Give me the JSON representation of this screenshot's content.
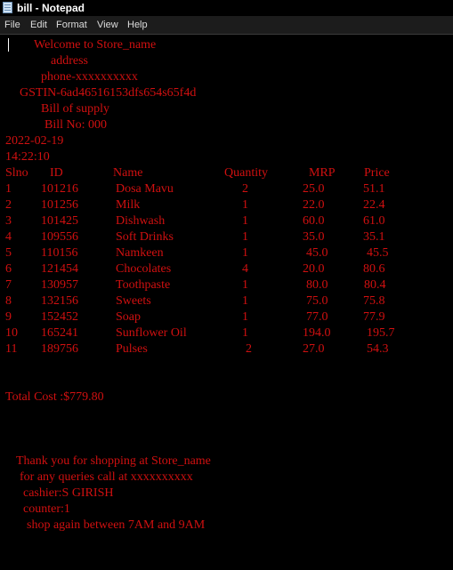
{
  "window": {
    "title": "bill - Notepad",
    "menu": [
      "File",
      "Edit",
      "Format",
      "View",
      "Help"
    ]
  },
  "bill": {
    "welcome": "Welcome to Store_name",
    "address": "address",
    "phone": "phone-xxxxxxxxxx",
    "gstin": "GSTIN-6ad46516153dfs654s65f4d",
    "supply": "Bill of supply",
    "bill_no": "Bill No: 000",
    "date": "2022-02-19",
    "time": "14:22:10",
    "columns": [
      "Slno",
      "ID",
      "Name",
      "Quantity",
      "MRP",
      "Price"
    ],
    "items": [
      {
        "slno": "1",
        "id": "101216",
        "name": "Dosa Mavu",
        "qty": "2",
        "mrp": "25.0",
        "price": "51.1"
      },
      {
        "slno": "2",
        "id": "101256",
        "name": "Milk",
        "qty": "1",
        "mrp": "22.0",
        "price": "22.4"
      },
      {
        "slno": "3",
        "id": "101425",
        "name": "Dishwash",
        "qty": "1",
        "mrp": "60.0",
        "price": "61.0"
      },
      {
        "slno": "4",
        "id": "109556",
        "name": "Soft Drinks",
        "qty": "1",
        "mrp": "35.0",
        "price": "35.1"
      },
      {
        "slno": "5",
        "id": "110156",
        "name": "Namkeen",
        "qty": "1",
        "mrp": "45.0",
        "price": "45.5"
      },
      {
        "slno": "6",
        "id": "121454",
        "name": "Chocolates",
        "qty": "4",
        "mrp": "20.0",
        "price": "80.6"
      },
      {
        "slno": "7",
        "id": "130957",
        "name": "Toothpaste",
        "qty": "1",
        "mrp": "80.0",
        "price": "80.4"
      },
      {
        "slno": "8",
        "id": "132156",
        "name": "Sweets",
        "qty": "1",
        "mrp": "75.0",
        "price": "75.8"
      },
      {
        "slno": "9",
        "id": "152452",
        "name": "Soap",
        "qty": "1",
        "mrp": "77.0",
        "price": "77.9"
      },
      {
        "slno": "10",
        "id": "165241",
        "name": "Sunflower Oil",
        "qty": "1",
        "mrp": "194.0",
        "price": "195.7"
      },
      {
        "slno": "11",
        "id": "189756",
        "name": "Pulses",
        "qty": "2",
        "mrp": "27.0",
        "price": "54.3"
      }
    ],
    "total": "Total Cost :$779.80",
    "thanks": "Thank you for shopping at Store_name",
    "queries": "for any queries call at xxxxxxxxxx",
    "cashier": "cashier:S GIRISH",
    "counter": "counter:1",
    "hours": "shop again between 7AM and 9AM"
  },
  "colors": {
    "text": "#d01010",
    "background": "#000000",
    "menubar": "#1c1c1c"
  },
  "icons": {
    "app": "notepad-icon"
  }
}
